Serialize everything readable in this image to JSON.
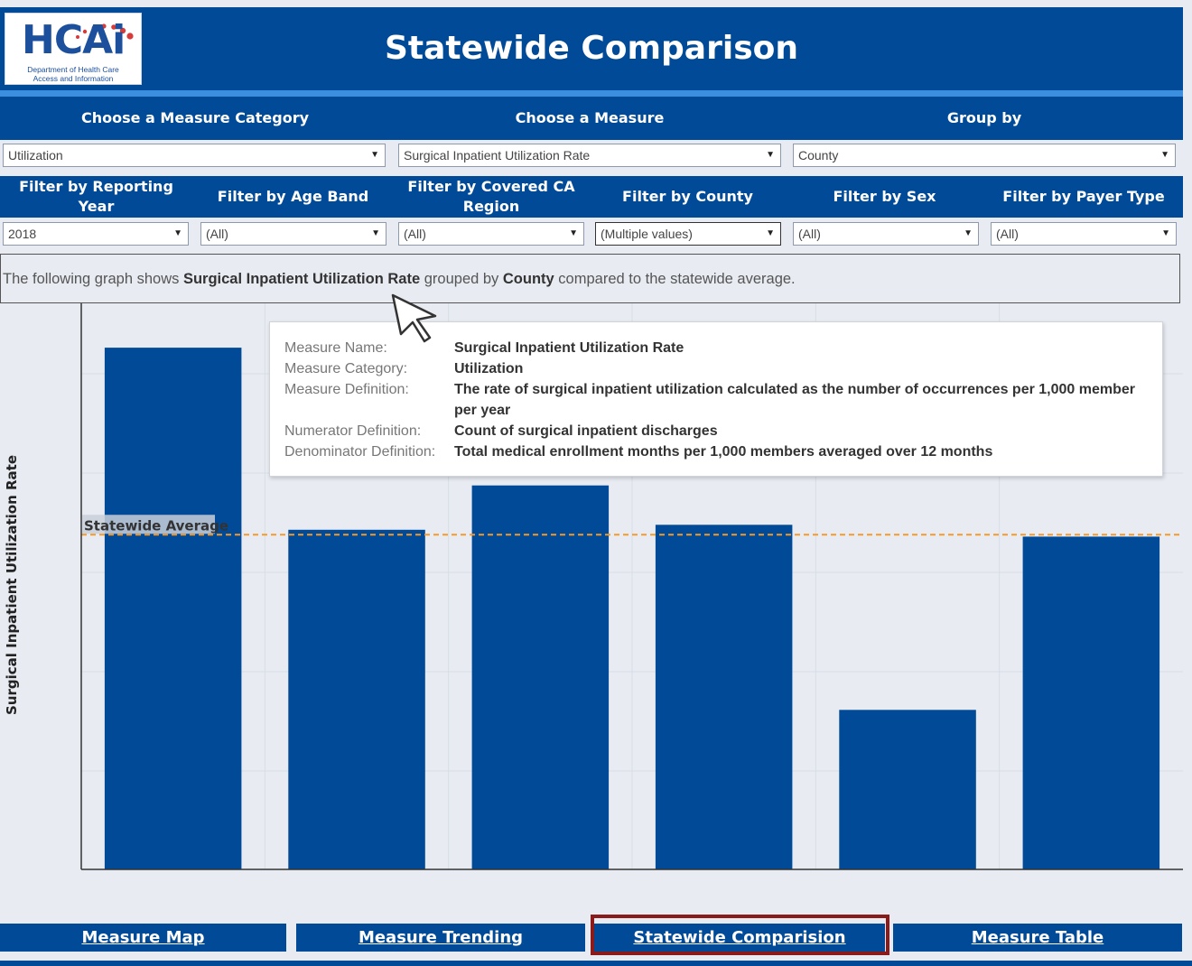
{
  "header": {
    "logo_text": "HCAi",
    "logo_subtitle_1": "Department of Health Care",
    "logo_subtitle_2": "Access and Information",
    "title": "Statewide Comparison"
  },
  "selectors": {
    "category_label": "Choose a Measure Category",
    "measure_label": "Choose a Measure",
    "groupby_label": "Group by",
    "category_value": "Utilization",
    "measure_value": "Surgical Inpatient Utilization Rate",
    "groupby_value": "County"
  },
  "filters": [
    {
      "label": "Filter by Reporting Year",
      "value": "2018"
    },
    {
      "label": "Filter by Age Band",
      "value": "(All)"
    },
    {
      "label": "Filter by Covered CA Region",
      "value": "(All)"
    },
    {
      "label": "Filter by County",
      "value": "(Multiple values)"
    },
    {
      "label": "Filter by Sex",
      "value": "(All)"
    },
    {
      "label": "Filter by Payer Type",
      "value": "(All)"
    }
  ],
  "description": {
    "prefix": "The following graph shows ",
    "measure": "Surgical Inpatient Utilization Rate",
    "middle": " grouped by ",
    "group": "County",
    "suffix": " compared to the statewide average."
  },
  "tooltip": {
    "rows": [
      {
        "key": "Measure Name:",
        "value": "Surgical Inpatient Utilization Rate"
      },
      {
        "key": "Measure Category:",
        "value": "Utilization"
      },
      {
        "key": "Measure Definition:",
        "value": "The rate of surgical inpatient utilization calculated as the number of occurrences per 1,000 member per year"
      },
      {
        "key": "Numerator Definition:",
        "value": "Count of surgical inpatient discharges"
      },
      {
        "key": "Denominator Definition:",
        "value": "Total medical enrollment months per 1,000 members averaged over 12 months"
      }
    ]
  },
  "chart_data": {
    "type": "bar",
    "ylabel": "Surgical Inpatient Utilization Rate",
    "categories": [
      "",
      "",
      "",
      "",
      "",
      ""
    ],
    "values": [
      5.3,
      3.45,
      3.9,
      3.5,
      1.62,
      3.38
    ],
    "ylim": [
      0,
      5.75
    ],
    "reference_line": {
      "label": "Statewide Average",
      "value": 3.4,
      "color": "#f39a2c"
    },
    "bar_color": "#004a98",
    "grid": true
  },
  "nav": {
    "items": [
      "Measure Map",
      "Measure Trending",
      "Statewide Comparision",
      "Measure Table"
    ],
    "active_index": 2
  },
  "colors": {
    "brand": "#004a98",
    "accent_stripe": "#3c8ede",
    "average_line": "#f39a2c",
    "highlight_border": "#8b1a1a"
  }
}
